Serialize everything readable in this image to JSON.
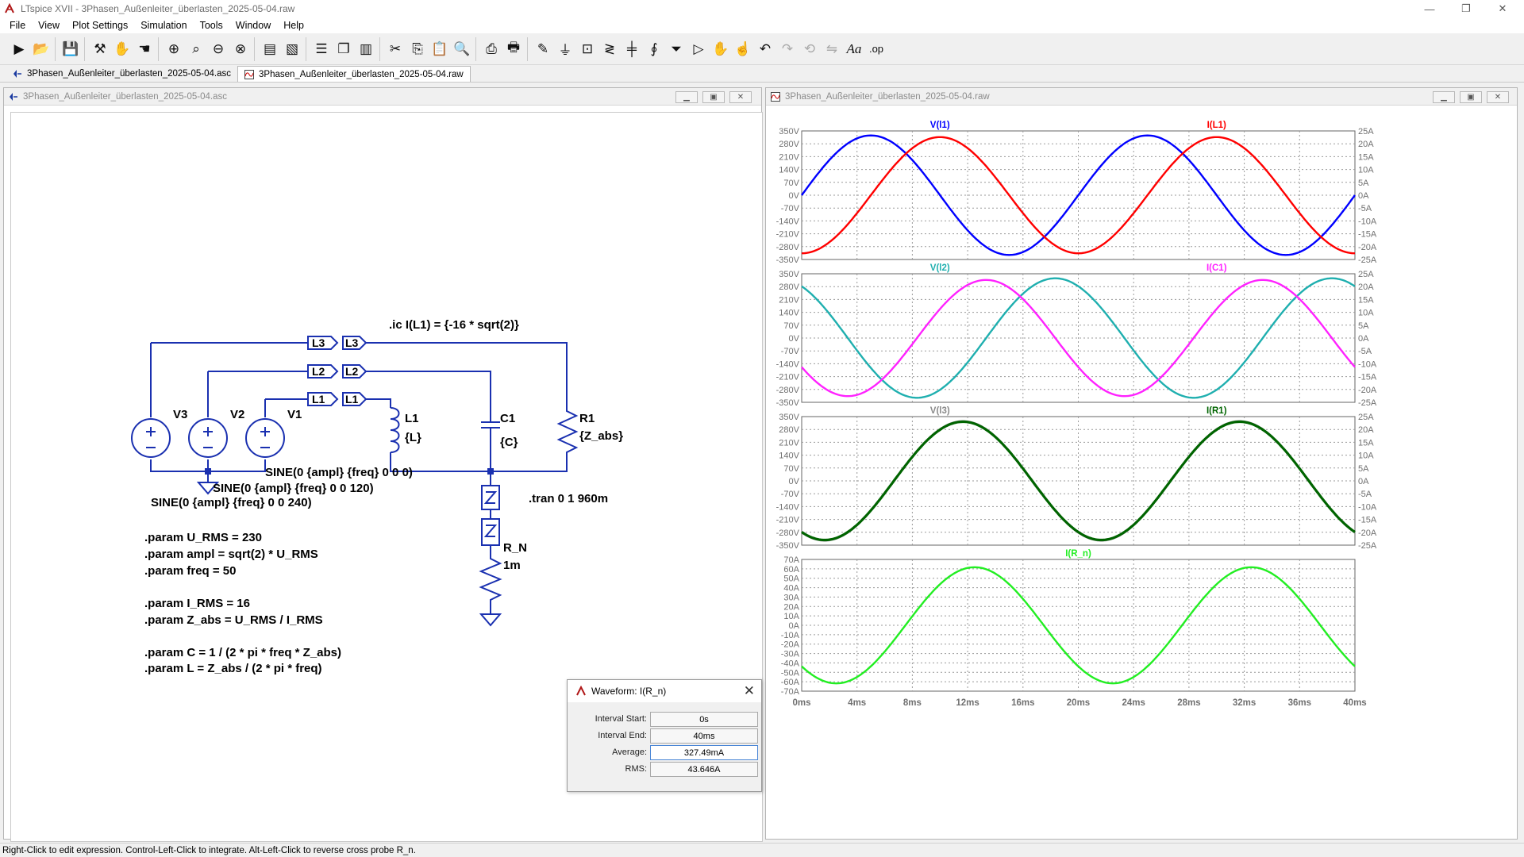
{
  "app": {
    "title": "LTspice XVII - 3Phasen_Außenleiter_überlasten_2025-05-04.raw",
    "minimize": "—",
    "restore": "❐",
    "close": "✕"
  },
  "menu": [
    "File",
    "View",
    "Plot Settings",
    "Simulation",
    "Tools",
    "Window",
    "Help"
  ],
  "toolbar_icons": [
    "run-icon",
    "open-icon",
    "save-icon",
    "control-panel-icon",
    "halt-icon",
    "pan-icon",
    "zoom-in-icon",
    "zoom-full-icon",
    "zoom-out-icon",
    "zoom-cancel-icon",
    "autorange-icon",
    "clear-plot-icon",
    "tile-horizontal-icon",
    "cascade-icon",
    "tile-vertical-icon",
    "cut-icon",
    "copy-icon",
    "paste-icon",
    "find-icon",
    "print-icon",
    "print-preview-icon",
    "draw-wire-icon",
    "ground-icon",
    "label-net-icon",
    "resistor-icon",
    "capacitor-icon",
    "inductor-icon",
    "diode-icon",
    "component-icon",
    "move-icon",
    "drag-icon",
    "undo-icon",
    "redo-icon",
    "rotate-icon",
    "mirror-icon",
    "text-icon",
    "spice-directive-icon"
  ],
  "tabs": [
    {
      "label": "3Phasen_Außenleiter_überlasten_2025-05-04.asc"
    },
    {
      "label": "3Phasen_Außenleiter_überlasten_2025-05-04.raw"
    }
  ],
  "schematic": {
    "title": "3Phasen_Außenleiter_überlasten_2025-05-04.asc",
    "labels": {
      "L3": "L3",
      "L2": "L2",
      "L1": "L1",
      "V1": "V1",
      "V2": "V2",
      "V3": "V3",
      "L1comp": "L1",
      "Lval": "{L}",
      "C1": "C1",
      "Cval": "{C}",
      "R1": "R1",
      "Rval": "{Z_abs}",
      "RN": "R_N",
      "RNval": "1m"
    },
    "ic": ".ic I(L1) = {-16 * sqrt(2)}",
    "sine1": "SINE(0 {ampl} {freq} 0 0 0)",
    "sine2": "SINE(0 {ampl} {freq} 0 0 120)",
    "sine3": "SINE(0 {ampl} {freq} 0 0 240)",
    "tran": ".tran 0 1 960m",
    "params": [
      ".param U_RMS = 230",
      ".param ampl = sqrt(2) * U_RMS",
      ".param freq = 50",
      "",
      ".param I_RMS = 16",
      ".param Z_abs = U_RMS / I_RMS",
      "",
      ".param C = 1 / (2 * pi * freq * Z_abs)",
      ".param L = Z_abs / (2 * pi * freq)"
    ]
  },
  "waveform_window": {
    "title": "3Phasen_Außenleiter_überlasten_2025-05-04.raw"
  },
  "chart_data": [
    {
      "type": "line",
      "x_unit": "ms",
      "x_ticks": [
        "0ms",
        "4ms",
        "8ms",
        "12ms",
        "16ms",
        "20ms",
        "24ms",
        "28ms",
        "32ms",
        "36ms",
        "40ms"
      ],
      "xlim": [
        0,
        40
      ],
      "y_ticks_left": [
        "350V",
        "280V",
        "210V",
        "140V",
        "70V",
        "0V",
        "-70V",
        "-140V",
        "-210V",
        "-280V",
        "-350V"
      ],
      "ylim_left": [
        -350,
        350
      ],
      "y_ticks_right": [
        "25A",
        "20A",
        "15A",
        "10A",
        "5A",
        "0A",
        "-5A",
        "-10A",
        "-15A",
        "-20A",
        "-25A"
      ],
      "ylim_right": [
        -25,
        25
      ],
      "grid": true,
      "series": [
        {
          "name": "V(l1)",
          "axis": "left",
          "color": "#0000ff",
          "amplitude": 325.3,
          "phase_deg": 0,
          "freq_hz": 50
        },
        {
          "name": "I(L1)",
          "axis": "right",
          "color": "#ff0000",
          "amplitude": 22.6,
          "phase_deg": -90,
          "freq_hz": 50
        }
      ]
    },
    {
      "type": "line",
      "x_unit": "ms",
      "x_ticks": [
        "0ms",
        "4ms",
        "8ms",
        "12ms",
        "16ms",
        "20ms",
        "24ms",
        "28ms",
        "32ms",
        "36ms",
        "40ms"
      ],
      "xlim": [
        0,
        40
      ],
      "y_ticks_left": [
        "350V",
        "280V",
        "210V",
        "140V",
        "70V",
        "0V",
        "-70V",
        "-140V",
        "-210V",
        "-280V",
        "-350V"
      ],
      "ylim_left": [
        -350,
        350
      ],
      "y_ticks_right": [
        "25A",
        "20A",
        "15A",
        "10A",
        "5A",
        "0A",
        "-5A",
        "-10A",
        "-15A",
        "-20A",
        "-25A"
      ],
      "ylim_right": [
        -25,
        25
      ],
      "grid": true,
      "series": [
        {
          "name": "V(l2)",
          "axis": "left",
          "color": "#1fafaf",
          "amplitude": 325.3,
          "phase_deg": 120,
          "freq_hz": 50
        },
        {
          "name": "I(C1)",
          "axis": "right",
          "color": "#ff22ff",
          "amplitude": 22.6,
          "phase_deg": 210,
          "freq_hz": 50
        }
      ]
    },
    {
      "type": "line",
      "x_unit": "ms",
      "x_ticks": [
        "0ms",
        "4ms",
        "8ms",
        "12ms",
        "16ms",
        "20ms",
        "24ms",
        "28ms",
        "32ms",
        "36ms",
        "40ms"
      ],
      "xlim": [
        0,
        40
      ],
      "y_ticks_left": [
        "350V",
        "280V",
        "210V",
        "140V",
        "70V",
        "0V",
        "-70V",
        "-140V",
        "-210V",
        "-280V",
        "-350V"
      ],
      "ylim_left": [
        -350,
        350
      ],
      "y_ticks_right": [
        "25A",
        "20A",
        "15A",
        "10A",
        "5A",
        "0A",
        "-5A",
        "-10A",
        "-15A",
        "-20A",
        "-25A"
      ],
      "ylim_right": [
        -25,
        25
      ],
      "grid": true,
      "series": [
        {
          "name": "V(l3)",
          "axis": "left",
          "color": "#8a8a8a",
          "amplitude": 325.3,
          "phase_deg": 240,
          "freq_hz": 50
        },
        {
          "name": "I(R1)",
          "axis": "right",
          "color": "#006400",
          "amplitude": 23.0,
          "phase_deg": 240,
          "freq_hz": 50
        }
      ]
    },
    {
      "type": "line",
      "x_unit": "ms",
      "x_ticks": [
        "0ms",
        "4ms",
        "8ms",
        "12ms",
        "16ms",
        "20ms",
        "24ms",
        "28ms",
        "32ms",
        "36ms",
        "40ms"
      ],
      "xlim": [
        0,
        40
      ],
      "y_ticks_left": [
        "70A",
        "60A",
        "50A",
        "40A",
        "30A",
        "20A",
        "10A",
        "0A",
        "-10A",
        "-20A",
        "-30A",
        "-40A",
        "-50A",
        "-60A",
        "-70A"
      ],
      "ylim_left": [
        -70,
        70
      ],
      "grid": true,
      "series": [
        {
          "name": "I(R_n)",
          "axis": "left",
          "color": "#22ee22",
          "amplitude": 61.7,
          "phase_deg": 225,
          "freq_hz": 50
        }
      ]
    }
  ],
  "waveform_dialog": {
    "title": "Waveform: I(R_n)",
    "interval_start_label": "Interval Start:",
    "interval_start": "0s",
    "interval_end_label": "Interval End:",
    "interval_end": "40ms",
    "average_label": "Average:",
    "average": "327.49mA",
    "rms_label": "RMS:",
    "rms": "43.646A"
  },
  "status": "Right-Click to edit expression. Control-Left-Click to integrate. Alt-Left-Click to reverse cross probe R_n."
}
